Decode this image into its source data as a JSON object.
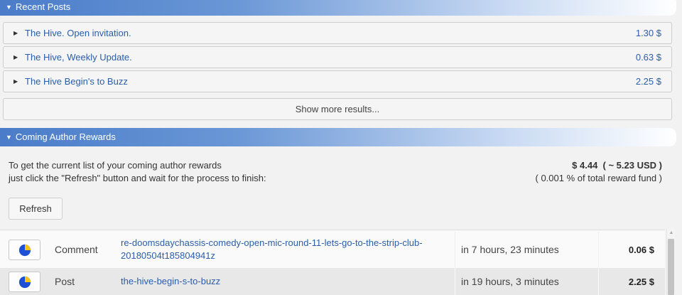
{
  "recent_posts": {
    "header": "Recent Posts",
    "items": [
      {
        "title": "The Hive. Open invitation.",
        "amount": "1.30 $"
      },
      {
        "title": "The Hive, Weekly Update.",
        "amount": "0.63 $"
      },
      {
        "title": "The Hive Begin's to Buzz",
        "amount": "2.25 $"
      }
    ],
    "show_more": "Show more results..."
  },
  "author_rewards": {
    "header": "Coming Author Rewards",
    "info_line1": "To get the current list of your coming author rewards",
    "info_line2": "just click the \"Refresh\" button and wait for the process to finish:",
    "total": "$ 4.44  ( ~ 5.23 USD )",
    "fund_share": "( 0.001 % of total reward fund )",
    "refresh_label": "Refresh",
    "rows": [
      {
        "type": "Comment",
        "link": "re-doomsdaychassis-comedy-open-mic-round-11-lets-go-to-the-strip-club-20180504t185804941z",
        "time": "in 7 hours, 23 minutes",
        "amount": "0.06 $"
      },
      {
        "type": "Post",
        "link": "the-hive-begin-s-to-buzz",
        "time": "in 19 hours, 3 minutes",
        "amount": "2.25 $"
      }
    ]
  },
  "colors": {
    "header_blue": "#4a7cc9",
    "link_blue": "#2a5daa",
    "pie_blue": "#1f4fd6",
    "pie_yellow": "#f3c417"
  },
  "icons": [
    "caret-down-icon",
    "caret-right-icon",
    "pie-chart-icon",
    "scroll-up-arrow-icon"
  ]
}
